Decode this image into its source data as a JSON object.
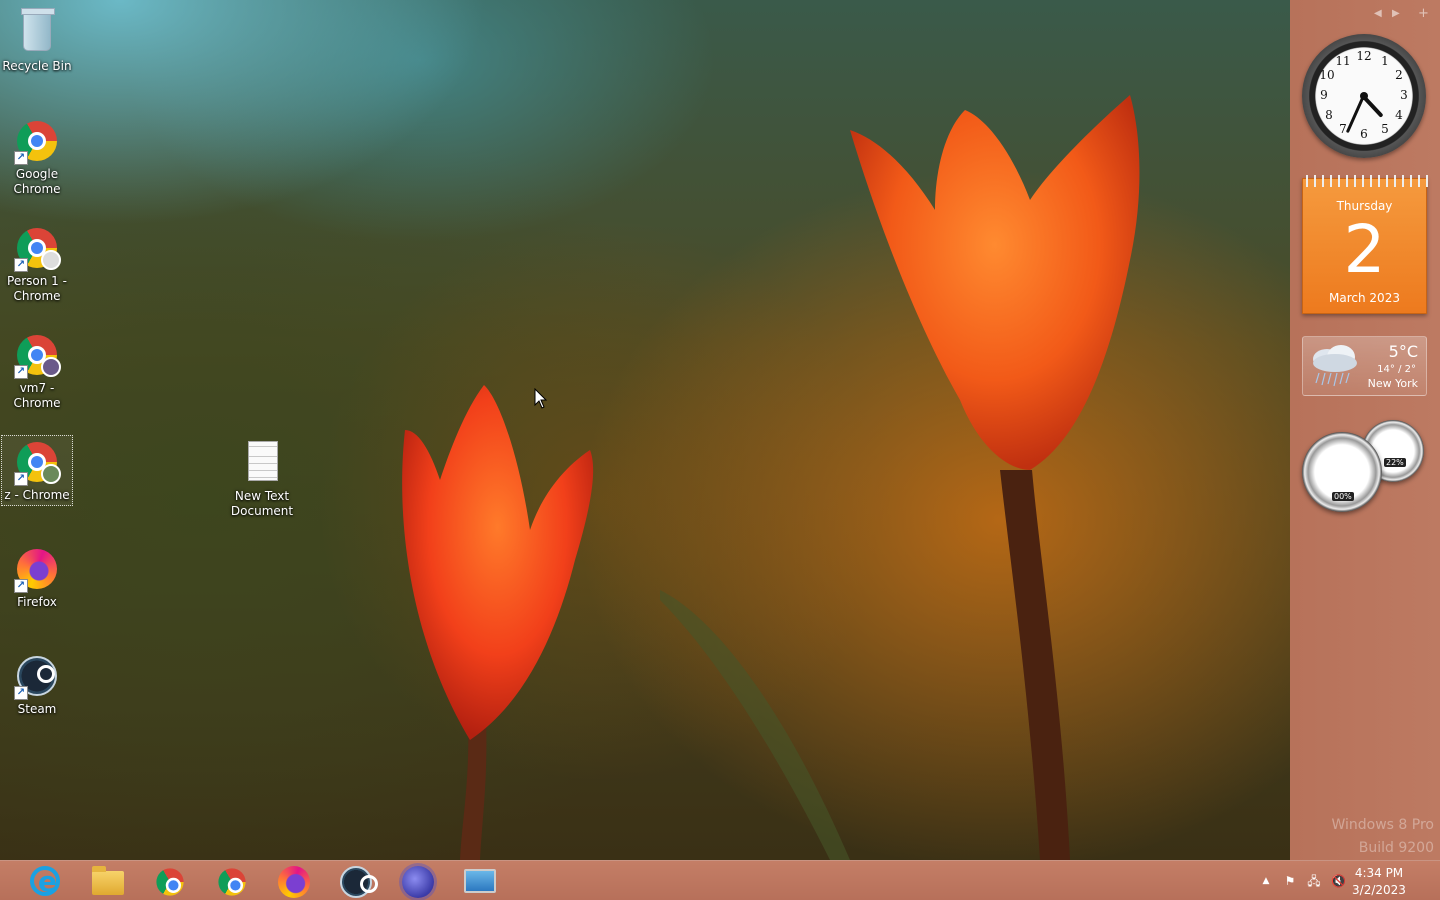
{
  "desktop": {
    "icons": [
      {
        "label": "Recycle Bin"
      },
      {
        "label": "Google Chrome"
      },
      {
        "label": "Person 1 - Chrome"
      },
      {
        "label": "vm7 - Chrome"
      },
      {
        "label": "z - Chrome"
      },
      {
        "label": "Firefox"
      },
      {
        "label": "Steam"
      },
      {
        "label": "New Text Document"
      }
    ]
  },
  "gadgets": {
    "clock": {
      "numbers": [
        "12",
        "1",
        "2",
        "3",
        "4",
        "5",
        "6",
        "7",
        "8",
        "9",
        "10",
        "11"
      ],
      "time": "4:34"
    },
    "calendar": {
      "weekday": "Thursday",
      "day": "2",
      "month_year": "March 2023"
    },
    "weather": {
      "temp": "5°C",
      "hilo": "14° / 2°",
      "city": "New York"
    },
    "cpu_meter": {
      "cpu": "00%",
      "ram": "22%"
    }
  },
  "watermark": {
    "line1": "Windows 8 Pro",
    "line2": "Build 9200"
  },
  "taskbar": {
    "pinned": [
      "internet-explorer",
      "file-explorer",
      "google-chrome",
      "chrome-profile",
      "firefox",
      "steam",
      "app-spiky",
      "remote-desktop"
    ],
    "clock_time": "4:34 PM",
    "clock_date": "3/2/2023"
  },
  "colors": {
    "taskbar": "#b7705a",
    "calendar": "#ed7a1e",
    "sidebar": "#b7725a"
  }
}
